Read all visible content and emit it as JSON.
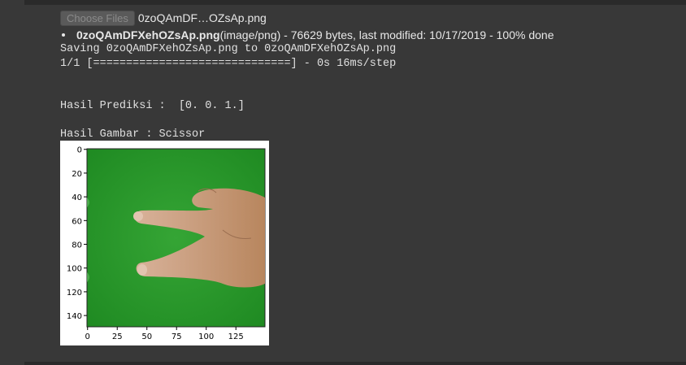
{
  "upload": {
    "button_label": "Choose Files",
    "selected_file": "0zoQAmDF…OZsAp.png",
    "file_name": "0zoQAmDFXehOZsAp.png",
    "file_info": "(image/png) - 76629 bytes, last modified: 10/17/2019 - 100% done"
  },
  "log": {
    "saving": "Saving 0zoQAmDFXehOZsAp.png to 0zoQAmDFXehOZsAp.png",
    "progress": "1/1 [==============================] - 0s 16ms/step",
    "prediction": "Hasil Prediksi :  [0. 0. 1.]",
    "result": "Hasil Gambar : Scissor"
  },
  "plot": {
    "y_ticks": [
      "0",
      "20",
      "40",
      "60",
      "80",
      "100",
      "120",
      "140"
    ],
    "x_ticks": [
      "0",
      "25",
      "50",
      "75",
      "100",
      "125"
    ],
    "colors": {
      "background": "#2f9b2f",
      "skin": "#c99a78"
    }
  }
}
